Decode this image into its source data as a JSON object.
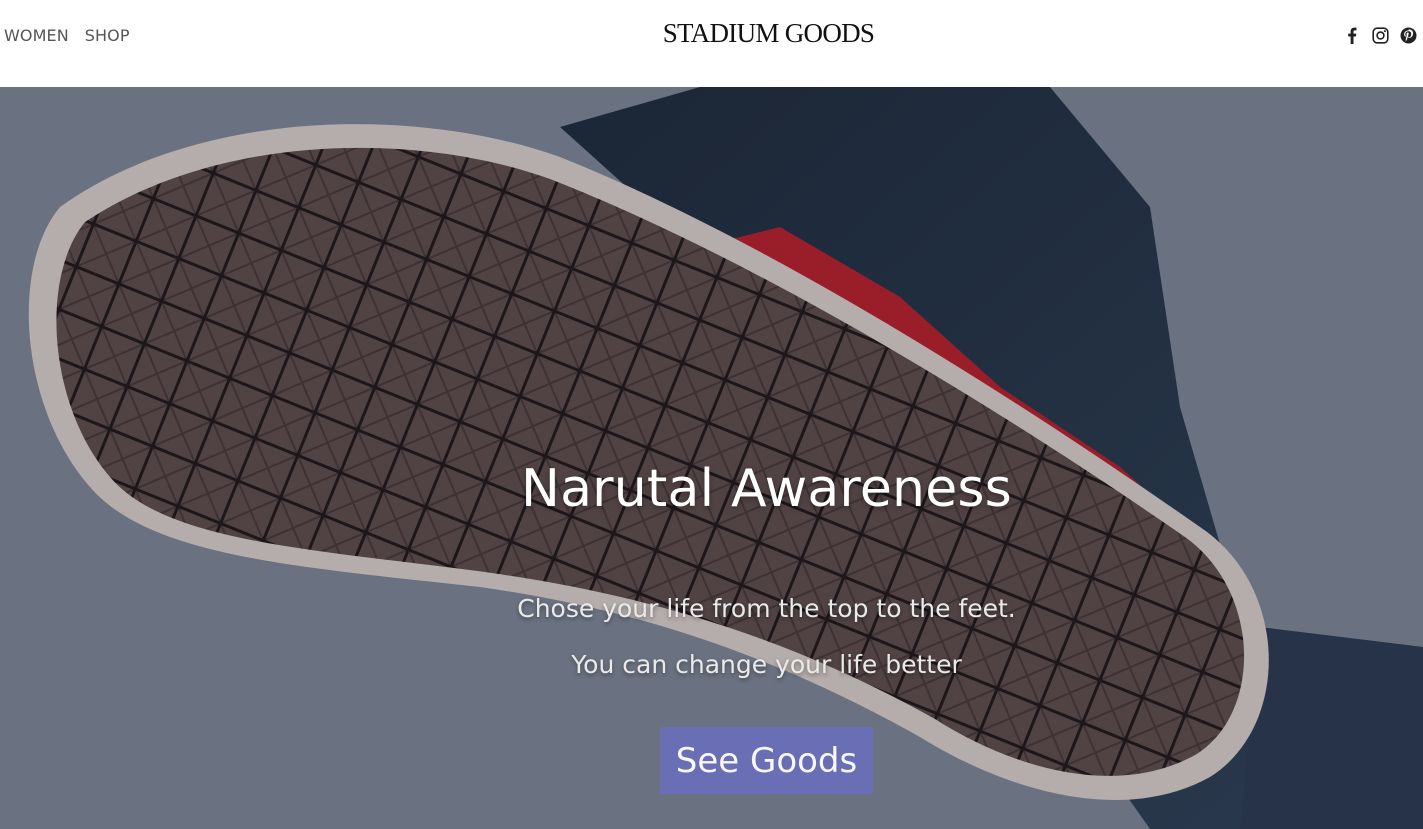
{
  "header": {
    "nav": [
      {
        "label": "WOMEN"
      },
      {
        "label": "SHOP"
      }
    ],
    "brand": "STADIUM GOODS",
    "social": [
      {
        "icon": "facebook-icon"
      },
      {
        "icon": "instagram-icon"
      },
      {
        "icon": "pinterest-icon"
      }
    ]
  },
  "hero": {
    "title": "Narutal Awareness",
    "subtitle_line1": "Chose your life from the top to the feet.",
    "subtitle_line2": "You can change your life better",
    "cta_label": "See Goods"
  },
  "colors": {
    "cta_bg": "#6a6fb8",
    "header_bg": "#ffffff",
    "text_dark": "#111111"
  }
}
